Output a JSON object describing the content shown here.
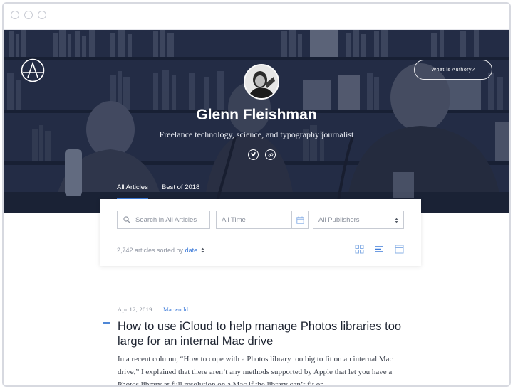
{
  "hero": {
    "what_button": "What is Authory?",
    "name": "Glenn Fleishman",
    "tagline": "Freelance technology, science, and typography journalist",
    "tabs": [
      "All Articles",
      "Best of 2018"
    ]
  },
  "filters": {
    "search_placeholder": "Search in All Articles",
    "time_value": "All Time",
    "publisher_value": "All Publishers",
    "count_text": "2,742 articles sorted by",
    "sort_value": "date"
  },
  "article": {
    "date": "Apr 12, 2019",
    "publication": "Macworld",
    "title": "How to use iCloud to help manage Photos libraries too large for an internal Mac drive",
    "excerpt": "In a recent column, “How to cope with a Photos library too big to fit on an internal Mac drive,” I explained that there aren’t any methods supported by Apple that let you have a Photos library at full resolution on a Mac if the library can’t fit on..."
  },
  "icons": [
    "authory-logo-icon",
    "twitter-icon",
    "link-icon",
    "calendar-icon",
    "sort-arrows-icon",
    "grid-view-icon",
    "list-view-icon",
    "table-view-icon"
  ],
  "colors": {
    "accent": "#3d7bd9",
    "hero_dark": "#27324a"
  }
}
